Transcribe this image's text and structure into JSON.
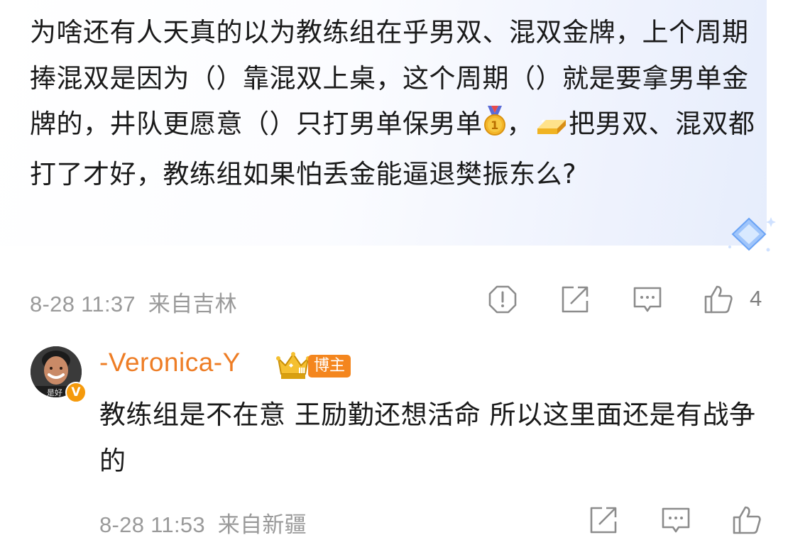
{
  "post": {
    "text_before_medal": "为啥还有人天真的以为教练组在乎男双、混双金牌，上个周期捧混双是因为（）靠混双上桌，这个周期（）就是要拿男单金牌的，井队更愿意（）只打男单保男单",
    "text_between": "，",
    "text_after_gold": "把男双、混双都打了才好，教练组如果怕丢金能逼退樊振东么?",
    "medal_emoji": "first-place-medal",
    "gold_emoji": "gold-bar",
    "timestamp": "8-28 11:37",
    "location": "来自吉林",
    "actions": [
      "report-icon",
      "share-icon",
      "comment-icon",
      "like-icon"
    ],
    "like_count": "4"
  },
  "reply": {
    "author": "-Veronica-Y",
    "level_badge": "Ⅲ",
    "role_tag": "博主",
    "verified_mark": "V",
    "avatar_caption": "是好",
    "text": "教练组是不在意 王励勤还想活命 所以这里面还是有战争的",
    "timestamp": "8-28 11:53",
    "location": "来自新疆",
    "actions": [
      "share-icon",
      "comment-icon",
      "like-icon"
    ]
  },
  "colors": {
    "name_orange": "#ee7d25",
    "meta_gray": "#9a9a9a",
    "icon_gray": "#8c8c8c"
  }
}
